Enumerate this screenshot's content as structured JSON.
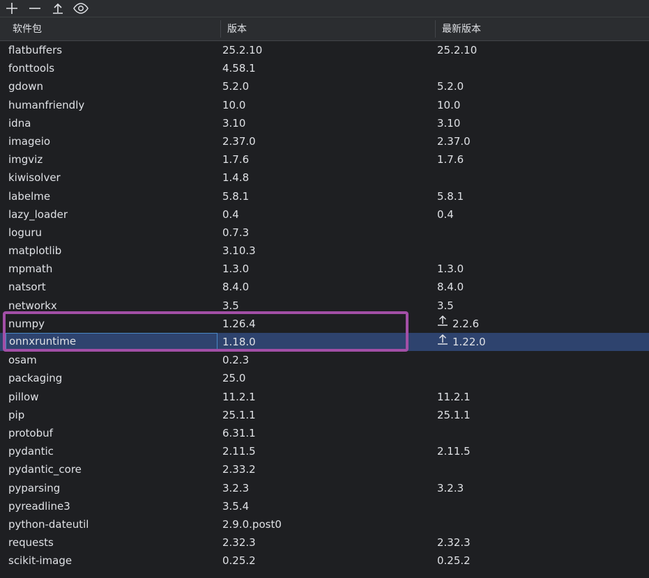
{
  "toolbar": {
    "buttons": [
      {
        "name": "add",
        "icon": "plus-icon"
      },
      {
        "name": "remove",
        "icon": "minus-icon"
      },
      {
        "name": "upgrade",
        "icon": "upgrade-arrow-icon"
      },
      {
        "name": "show-latest",
        "icon": "eye-icon"
      }
    ]
  },
  "table": {
    "headers": [
      "软件包",
      "版本",
      "最新版本"
    ],
    "rows": [
      {
        "name": "flatbuffers",
        "version": "25.2.10",
        "latest": "25.2.10",
        "upgrade": false
      },
      {
        "name": "fonttools",
        "version": "4.58.1",
        "latest": "",
        "upgrade": false
      },
      {
        "name": "gdown",
        "version": "5.2.0",
        "latest": "5.2.0",
        "upgrade": false
      },
      {
        "name": "humanfriendly",
        "version": "10.0",
        "latest": "10.0",
        "upgrade": false
      },
      {
        "name": "idna",
        "version": "3.10",
        "latest": "3.10",
        "upgrade": false
      },
      {
        "name": "imageio",
        "version": "2.37.0",
        "latest": "2.37.0",
        "upgrade": false
      },
      {
        "name": "imgviz",
        "version": "1.7.6",
        "latest": "1.7.6",
        "upgrade": false
      },
      {
        "name": "kiwisolver",
        "version": "1.4.8",
        "latest": "",
        "upgrade": false
      },
      {
        "name": "labelme",
        "version": "5.8.1",
        "latest": "5.8.1",
        "upgrade": false
      },
      {
        "name": "lazy_loader",
        "version": "0.4",
        "latest": "0.4",
        "upgrade": false
      },
      {
        "name": "loguru",
        "version": "0.7.3",
        "latest": "",
        "upgrade": false
      },
      {
        "name": "matplotlib",
        "version": "3.10.3",
        "latest": "",
        "upgrade": false
      },
      {
        "name": "mpmath",
        "version": "1.3.0",
        "latest": "1.3.0",
        "upgrade": false
      },
      {
        "name": "natsort",
        "version": "8.4.0",
        "latest": "8.4.0",
        "upgrade": false
      },
      {
        "name": "networkx",
        "version": "3.5",
        "latest": "3.5",
        "upgrade": false
      },
      {
        "name": "numpy",
        "version": "1.26.4",
        "latest": "2.2.6",
        "upgrade": true
      },
      {
        "name": "onnxruntime",
        "version": "1.18.0",
        "latest": "1.22.0",
        "upgrade": true,
        "selected": true
      },
      {
        "name": "osam",
        "version": "0.2.3",
        "latest": "",
        "upgrade": false
      },
      {
        "name": "packaging",
        "version": "25.0",
        "latest": "",
        "upgrade": false
      },
      {
        "name": "pillow",
        "version": "11.2.1",
        "latest": "11.2.1",
        "upgrade": false
      },
      {
        "name": "pip",
        "version": "25.1.1",
        "latest": "25.1.1",
        "upgrade": false
      },
      {
        "name": "protobuf",
        "version": "6.31.1",
        "latest": "",
        "upgrade": false
      },
      {
        "name": "pydantic",
        "version": "2.11.5",
        "latest": "2.11.5",
        "upgrade": false
      },
      {
        "name": "pydantic_core",
        "version": "2.33.2",
        "latest": "",
        "upgrade": false
      },
      {
        "name": "pyparsing",
        "version": "3.2.3",
        "latest": "3.2.3",
        "upgrade": false
      },
      {
        "name": "pyreadline3",
        "version": "3.5.4",
        "latest": "",
        "upgrade": false
      },
      {
        "name": "python-dateutil",
        "version": "2.9.0.post0",
        "latest": "",
        "upgrade": false
      },
      {
        "name": "requests",
        "version": "2.32.3",
        "latest": "2.32.3",
        "upgrade": false
      },
      {
        "name": "scikit-image",
        "version": "0.25.2",
        "latest": "0.25.2",
        "upgrade": false
      }
    ]
  },
  "colors": {
    "selection": "#2e436e",
    "highlight_box": "#a24fa6"
  }
}
